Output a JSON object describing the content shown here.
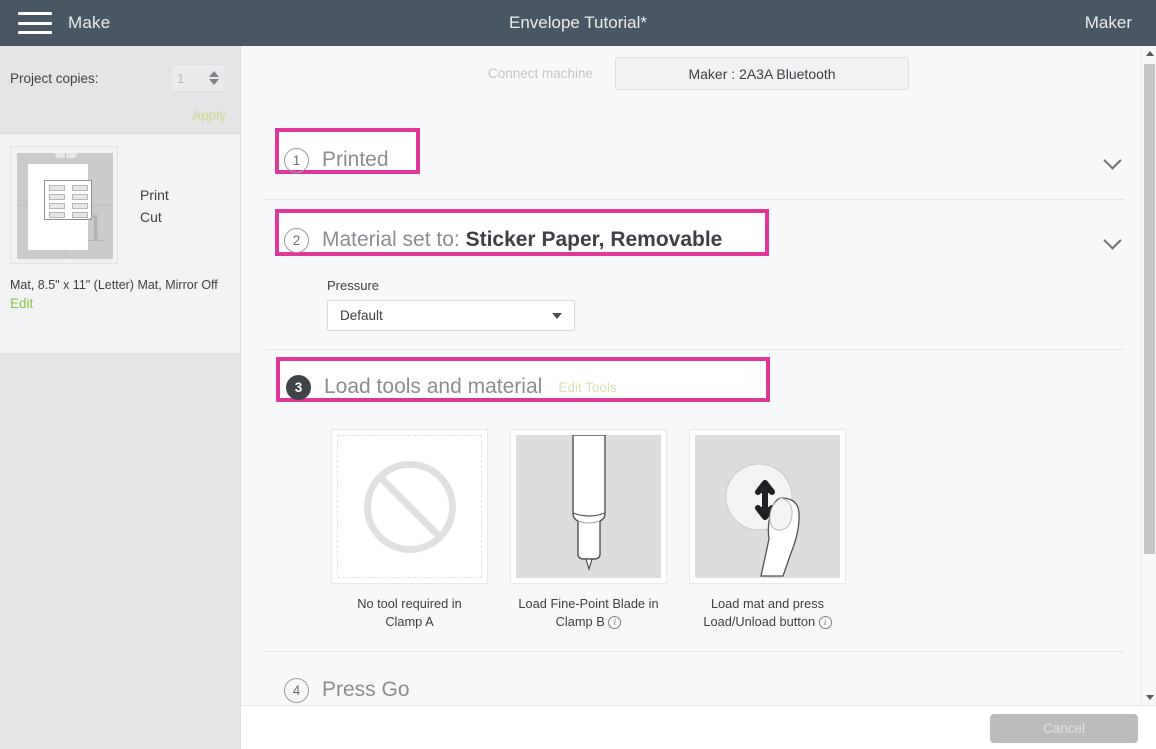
{
  "topbar": {
    "menu_icon": "hamburger-icon",
    "left_label": "Make",
    "title": "Envelope Tutorial*",
    "right_label": "Maker"
  },
  "sidebar": {
    "copies_label": "Project copies:",
    "copies_value": "1",
    "apply_label": "Apply",
    "mat_labels": [
      "Print",
      "Cut"
    ],
    "mat_caption": "Mat, 8.5\" x 11\" (Letter) Mat, Mirror Off",
    "edit_label": "Edit"
  },
  "main": {
    "connect_label": "Connect machine",
    "machine_name": "Maker : 2A3A Bluetooth",
    "sections": [
      {
        "number": "1",
        "title": "Printed",
        "title_bold": "",
        "highlighted": true,
        "collapsed": true,
        "chevron": "chevron-down-icon"
      },
      {
        "number": "2",
        "title": "Material set to: ",
        "title_bold": "Sticker Paper, Removable",
        "highlighted": true,
        "collapsed": true,
        "chevron": "chevron-down-icon"
      },
      {
        "number": "3",
        "title": "Load tools and material",
        "title_bold": "",
        "action_label": "Edit Tools",
        "highlighted": true,
        "collapsed": false
      },
      {
        "number": "4",
        "title": "Press Go",
        "title_bold": "",
        "highlighted": false,
        "collapsed": true
      }
    ],
    "pressure": {
      "label": "Pressure",
      "value": "Default",
      "caret_icon": "caret-down-icon"
    },
    "tool_cards": [
      {
        "icon": "no-tool-icon",
        "line1": "No tool required in",
        "line2": "Clamp A",
        "has_info": false
      },
      {
        "icon": "fine-point-blade-icon",
        "line1": "Load Fine-Point Blade in",
        "line2": "Clamp B",
        "has_info": true,
        "info_icon": "info-icon"
      },
      {
        "icon": "press-load-button-icon",
        "line1": "Load mat and press",
        "line2": "Load/Unload button",
        "has_info": true,
        "info_icon": "info-icon"
      }
    ]
  },
  "bottombar": {
    "cancel_label": "Cancel"
  },
  "colors": {
    "highlight_pink": "#e0359b",
    "topbar": "#485763",
    "accent_green": "#8cc63f"
  }
}
